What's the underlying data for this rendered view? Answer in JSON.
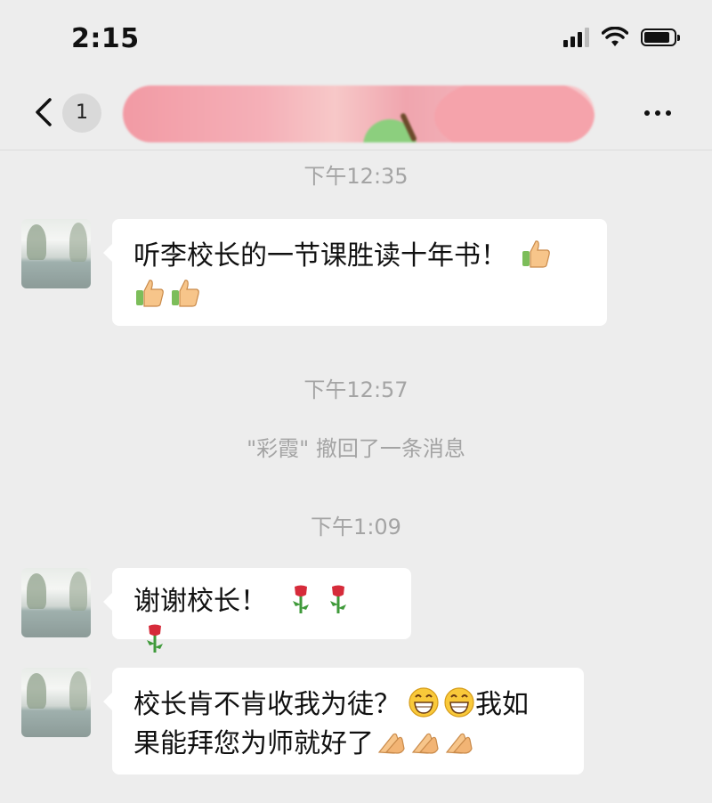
{
  "status_bar": {
    "time": "2:15",
    "battery_level": 0.85,
    "signal_bars": 4,
    "signal_bars_active": 3
  },
  "nav": {
    "unread_count": "1"
  },
  "chat": {
    "messages": [
      {
        "type": "timestamp",
        "text": "下午12:35"
      },
      {
        "type": "incoming",
        "text": "听李校长的一节课胜读十年书！",
        "emojis": [
          "thumbs-up-icon",
          "thumbs-up-icon",
          "thumbs-up-icon"
        ]
      },
      {
        "type": "timestamp",
        "text": "下午12:57"
      },
      {
        "type": "system",
        "text": "\"彩霞\" 撤回了一条消息"
      },
      {
        "type": "timestamp",
        "text": "下午1:09"
      },
      {
        "type": "incoming",
        "text": "谢谢校长！",
        "emojis": [
          "rose-icon",
          "rose-icon",
          "rose-icon"
        ]
      },
      {
        "type": "incoming",
        "text_a": "校长肯不肯收我为徒？",
        "text_b": "我如",
        "text_c": "果能拜您为师就好了",
        "emojis": [
          "grin-icon",
          "grin-icon",
          "clap-icon",
          "clap-icon",
          "clap-icon"
        ]
      }
    ]
  },
  "colors": {
    "background": "#ededed",
    "bubble": "#ffffff",
    "meta_text": "#a4a4a4"
  }
}
